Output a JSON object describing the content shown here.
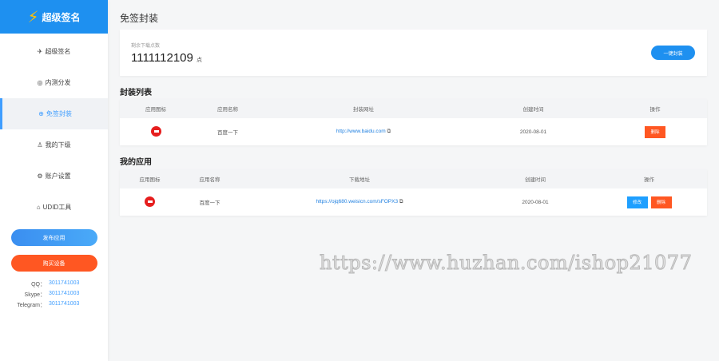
{
  "sidebar": {
    "brand": "超级签名",
    "items": [
      {
        "label": "超级签名",
        "icon": "send-icon"
      },
      {
        "label": "内测分发",
        "icon": "compass-icon"
      },
      {
        "label": "免签封装",
        "icon": "globe-icon"
      },
      {
        "label": "我的下级",
        "icon": "user-icon"
      },
      {
        "label": "账户设置",
        "icon": "gear-icon"
      },
      {
        "label": "UDID工具",
        "icon": "tag-icon"
      }
    ],
    "publish": "发布应用",
    "buy": "购买设备",
    "contacts": [
      {
        "k": "QQ：",
        "v": "3011741003"
      },
      {
        "k": "Skype：",
        "v": "3011741003"
      },
      {
        "k": "Telegram：",
        "v": "3011741003"
      }
    ]
  },
  "main": {
    "title": "免签封装",
    "remain_label": "剩余下载点数",
    "remain": "1111112109",
    "unit": "点",
    "pack_btn": "一键封装",
    "pack_list": {
      "title": "封装列表",
      "headers": [
        "应用图标",
        "应用名称",
        "封装网址",
        "创建时间",
        "操作"
      ],
      "rows": [
        {
          "name": "百度一下",
          "url": "http://www.baidu.com",
          "date": "2020-08-01",
          "del": "删除"
        }
      ]
    },
    "my_apps": {
      "title": "我的应用",
      "headers": [
        "应用图标",
        "应用名称",
        "下载地址",
        "创建时间",
        "操作"
      ],
      "rows": [
        {
          "name": "百度一下",
          "url": "https://ojq680.weisicn.com/sFOPX3",
          "date": "2020-08-01",
          "edit": "修改",
          "del": "删除"
        }
      ]
    }
  },
  "watermark": "https://www.huzhan.com/ishop21077"
}
